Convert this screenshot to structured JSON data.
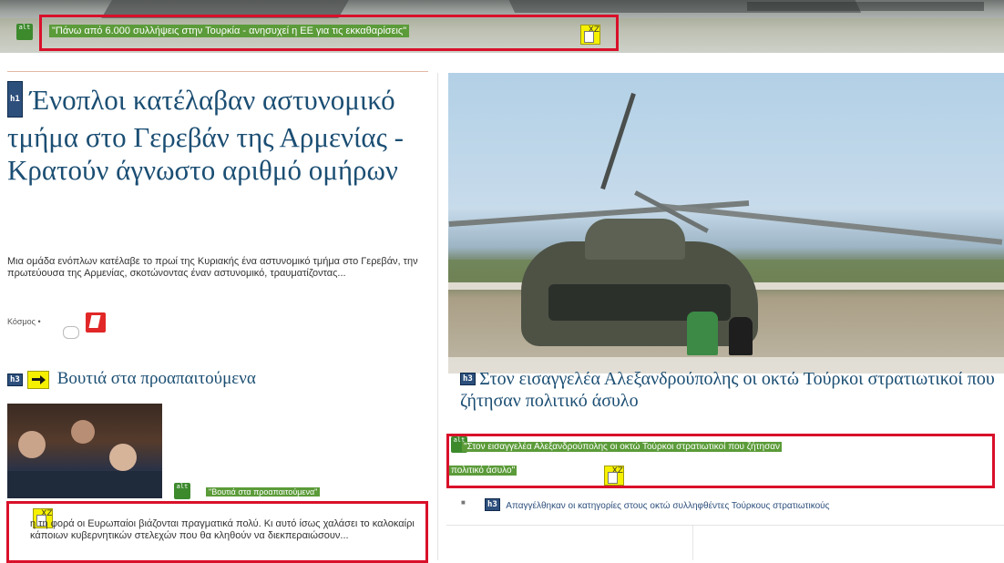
{
  "top_link": {
    "alt_icon_label": "alt",
    "text": "\"Πάνω από 6.000 συλλήψεις στην Τουρκία - ανησυχεί η ΕΕ για τις εκκαθαρίσεις\"",
    "xz_label": "XZ"
  },
  "main_article": {
    "heading_badge": "h1",
    "title": "Ένοπλοι κατέλαβαν αστυνομικό τμήμα στο Γερεβάν της Αρμενίας - Κρατούν άγνωστο αριθμό ομήρων",
    "summary": "Μια ομάδα ενόπλων κατέλαβε το πρωί της Κυριακής ένα αστυνομικό τμήμα στο Γερεβάν, την πρωτεύουσα της Αρμενίας, σκοτώνοντας έναν αστυνομικό, τραυματίζοντας...",
    "category": "Κόσμος",
    "category_sep": "•"
  },
  "secondary_article": {
    "heading_badge": "h3",
    "title": "Βουτιά στα προαπαιτούμενα",
    "alt_icon_label": "alt",
    "alt_text": "\"Βουτιά στα προαπαιτούμενα\"",
    "xz_label": "XZ",
    "summary": "η τη φορά οι Ευρωπαίοι βιάζονται πραγματικά πολύ. Κι αυτό ίσως χαλάσει το καλοκαίρι κάποιων κυβερνητικών στελεχών που θα κληθούν να διεκπεραιώσουν..."
  },
  "featured_article": {
    "heading_badge": "h3",
    "title": "Στον εισαγγελέα Αλεξανδρούπολης οι οκτώ Τούρκοι στρατιωτικοί που ζήτησαν πολιτικό άσυλο",
    "alt_icon_label": "alt",
    "alt_text_line1": "\"Στον εισαγγελέα Αλεξανδρούπολης οι οκτώ Τούρκοι στρατιωτικοί που ζήτησαν",
    "alt_text_line2": "πολιτικό άσυλο\"",
    "xz_label": "XZ",
    "related_bullet": "■",
    "related_badge": "h3",
    "related_text": "Απαγγέλθηκαν οι κατηγορίες στους οκτώ συλληφθέντες Τούρκους στρατιωτικούς"
  },
  "colors": {
    "headline": "#1b4e73",
    "red_box": "#d9102a",
    "highlight_green": "#5b9b39",
    "badge_yellow": "#f6f100"
  }
}
